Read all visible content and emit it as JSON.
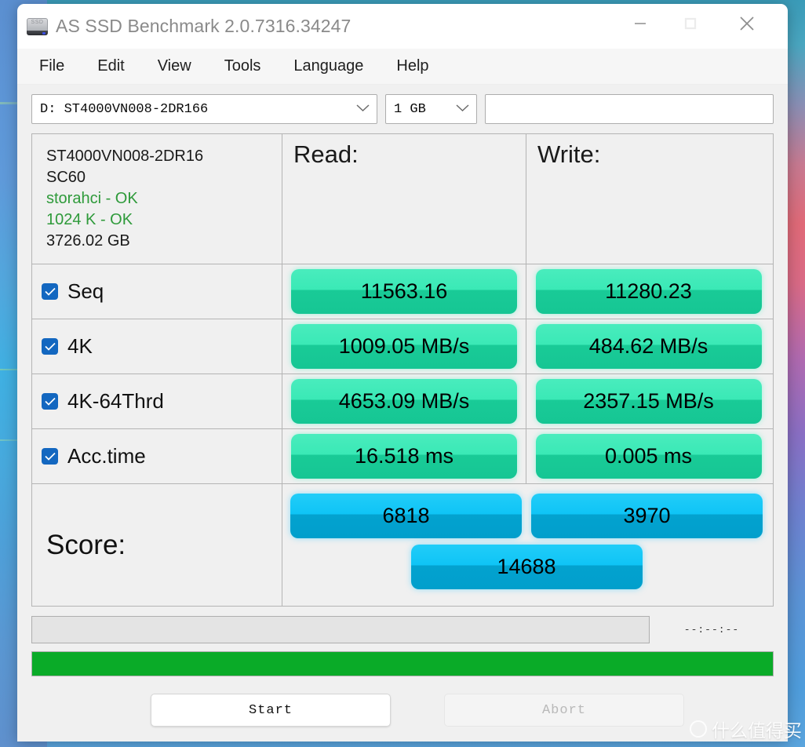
{
  "window": {
    "title": "AS SSD Benchmark 2.0.7316.34247",
    "icon": "ssd-drive-icon",
    "controls": {
      "minimize": "minimize-icon",
      "maximize": "maximize-icon",
      "close": "close-icon"
    }
  },
  "menu": {
    "items": [
      "File",
      "Edit",
      "View",
      "Tools",
      "Language",
      "Help"
    ]
  },
  "selector": {
    "drive": "D: ST4000VN008-2DR166",
    "size": "1 GB",
    "note": "",
    "chevron": "chevron-down-icon"
  },
  "drive_info": {
    "model": "ST4000VN008-2DR16",
    "firmware": "SC60",
    "driver": "storahci - OK",
    "alignment": "1024 K - OK",
    "capacity": "3726.02 GB"
  },
  "columns": {
    "read": "Read:",
    "write": "Write:"
  },
  "tests": [
    {
      "name": "Seq",
      "checked": true,
      "read": "11563.16",
      "write": "11280.23"
    },
    {
      "name": "4K",
      "checked": true,
      "read": "1009.05 MB/s",
      "write": "484.62 MB/s"
    },
    {
      "name": "4K-64Thrd",
      "checked": true,
      "read": "4653.09 MB/s",
      "write": "2357.15 MB/s"
    },
    {
      "name": "Acc.time",
      "checked": true,
      "read": "16.518 ms",
      "write": "0.005 ms"
    }
  ],
  "score": {
    "label": "Score:",
    "read": "6818",
    "write": "3970",
    "total": "14688"
  },
  "status": {
    "text": "",
    "timer": "--:--:--",
    "progress_percent": 100
  },
  "buttons": {
    "start": "Start",
    "abort": "Abort"
  },
  "watermark": {
    "text": "什么值得买"
  },
  "colors": {
    "accent_green": "#3ae9b6",
    "accent_green_dark": "#16c694",
    "accent_blue": "#0fc4f6",
    "accent_blue_dark": "#019fcc",
    "progress_green": "#0aab28",
    "checkbox_blue": "#1367c0",
    "ok_text_green": "#2e9a3a"
  }
}
